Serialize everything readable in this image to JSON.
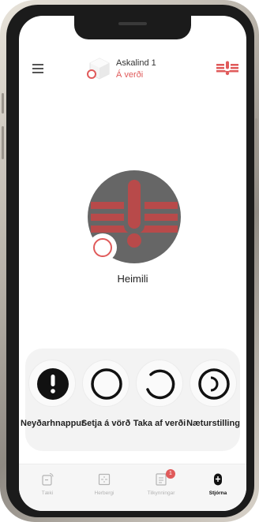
{
  "header": {
    "device_name": "Askalind 1",
    "status_text": "Á verði"
  },
  "main": {
    "location_name": "Heimili"
  },
  "actions": [
    {
      "label": "Neyðarhnappur",
      "icon": "exclamation-icon"
    },
    {
      "label": "Setja á vörð",
      "icon": "ring-icon"
    },
    {
      "label": "Taka af verði",
      "icon": "open-ring-icon"
    },
    {
      "label": "Næturstilling",
      "icon": "night-mode-icon"
    }
  ],
  "nav": {
    "items": [
      {
        "label": "Tæki",
        "icon": "device-icon"
      },
      {
        "label": "Herbergi",
        "icon": "room-icon"
      },
      {
        "label": "Tilkynningar",
        "icon": "notifications-icon",
        "badge": "1"
      },
      {
        "label": "Stjórna",
        "icon": "control-icon",
        "active": true
      }
    ]
  },
  "colors": {
    "alarm_red": "#e05a5a",
    "status_gray": "#666666",
    "panel_bg": "#f3f3f3"
  }
}
